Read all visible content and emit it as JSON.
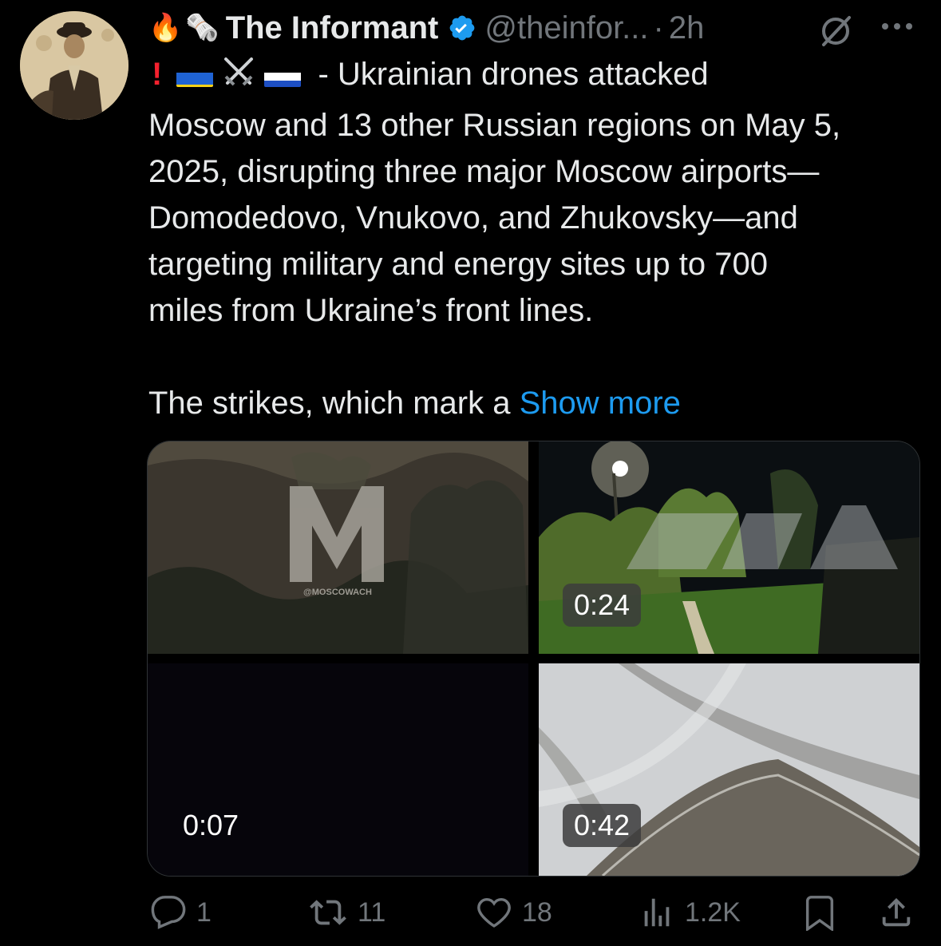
{
  "tweet": {
    "author_name": "The Informant",
    "handle": "@theinfor...",
    "separator": "·",
    "time": "2h",
    "header_emojis": [
      "🔥",
      "🗞️"
    ],
    "text_prefix_separator": " - ",
    "text_first_line": "Ukrainian drones attacked",
    "text_body": "Moscow and 13 other Russian regions on May 5,\n2025, disrupting three major Moscow airports—\nDomodedovo, Vnukovo, and Zhukovsky—and\ntargeting military and energy sites up to 700\nmiles from Ukraine’s front lines.\n\nThe strikes, which mark a ",
    "show_more": "Show more",
    "media": [
      {
        "duration": "",
        "watermark": "@MOSCOWACH"
      },
      {
        "duration": "0:24"
      },
      {
        "duration": "0:07"
      },
      {
        "duration": "0:42"
      }
    ],
    "stats": {
      "replies": "1",
      "reposts": "11",
      "likes": "18",
      "views": "1.2K"
    }
  },
  "colors": {
    "background": "#000000",
    "text": "#e7e9ea",
    "muted": "#71767b",
    "link": "#1d9bf0",
    "verified": "#1d9bf0",
    "alert": "#f4212e"
  },
  "icons": [
    "fire-icon",
    "newspaper-icon",
    "verified-badge-icon",
    "grok-icon",
    "more-icon",
    "exclamation-icon",
    "ukraine-flag-icon",
    "crossed-swords-icon",
    "russia-flag-icon",
    "reply-icon",
    "repost-icon",
    "like-icon",
    "views-icon",
    "bookmark-icon",
    "share-icon"
  ]
}
